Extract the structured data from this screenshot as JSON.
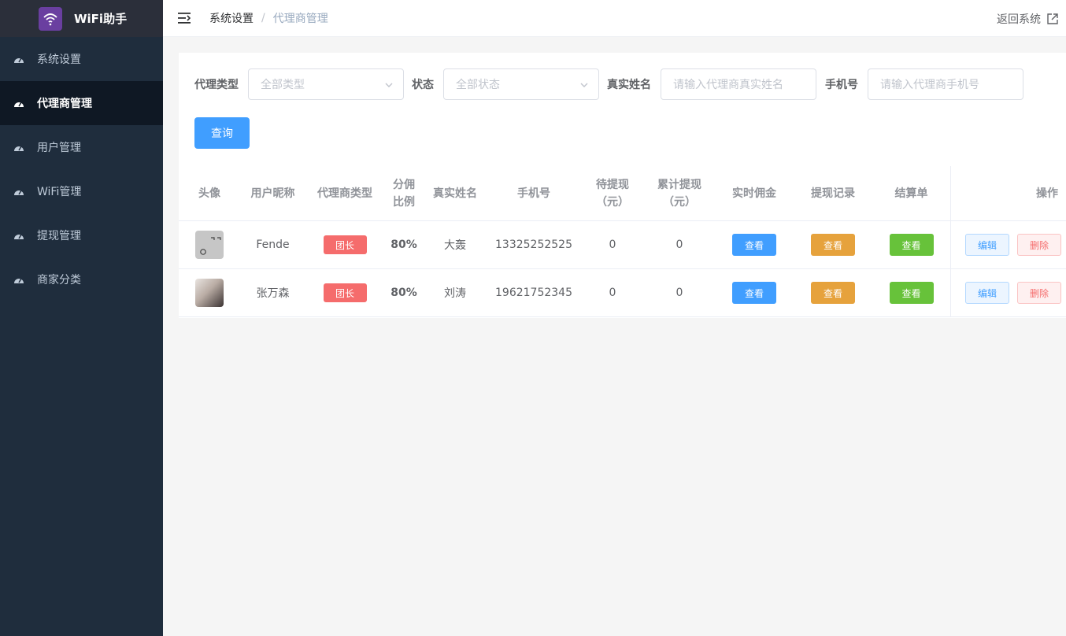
{
  "sidebar": {
    "app_title": "WiFi助手",
    "items": [
      {
        "label": "系统设置",
        "icon": "dashboard-icon",
        "active": false
      },
      {
        "label": "代理商管理",
        "icon": "dashboard-icon",
        "active": true
      },
      {
        "label": "用户管理",
        "icon": "dashboard-icon",
        "active": false
      },
      {
        "label": "WiFi管理",
        "icon": "dashboard-icon",
        "active": false
      },
      {
        "label": "提现管理",
        "icon": "dashboard-icon",
        "active": false
      },
      {
        "label": "商家分类",
        "icon": "dashboard-icon",
        "active": false
      }
    ]
  },
  "header": {
    "breadcrumb_home": "系统设置",
    "breadcrumb_sep": "/",
    "breadcrumb_current": "代理商管理",
    "back_label": "返回系统"
  },
  "filters": {
    "type_label": "代理类型",
    "type_placeholder": "全部类型",
    "status_label": "状态",
    "status_placeholder": "全部状态",
    "name_label": "真实姓名",
    "name_placeholder": "请输入代理商真实姓名",
    "phone_label": "手机号",
    "phone_placeholder": "请输入代理商手机号",
    "query_label": "查询"
  },
  "table": {
    "headers": [
      "头像",
      "用户昵称",
      "代理商类型",
      "分佣\n比例",
      "真实姓名",
      "手机号",
      "待提现\n（元）",
      "累计提现\n（元）",
      "实时佣金",
      "提现记录",
      "结算单",
      "操作"
    ],
    "rows": [
      {
        "nickname": "Fende",
        "agent_type": "团长",
        "ratio": "80%",
        "real_name": "大轰",
        "phone": "13325252525",
        "pending": "0",
        "total": "0",
        "view": "查看",
        "edit": "编辑",
        "delete": "删除"
      },
      {
        "nickname": "张万森",
        "agent_type": "团长",
        "ratio": "80%",
        "real_name": "刘涛",
        "phone": "19621752345",
        "pending": "0",
        "total": "0",
        "view": "查看",
        "edit": "编辑",
        "delete": "删除"
      }
    ]
  },
  "colors": {
    "sidebar_bg": "#1f2d3d",
    "primary": "#409eff",
    "danger": "#f56c6c",
    "warning": "#e6a23c",
    "success": "#67c23a"
  }
}
